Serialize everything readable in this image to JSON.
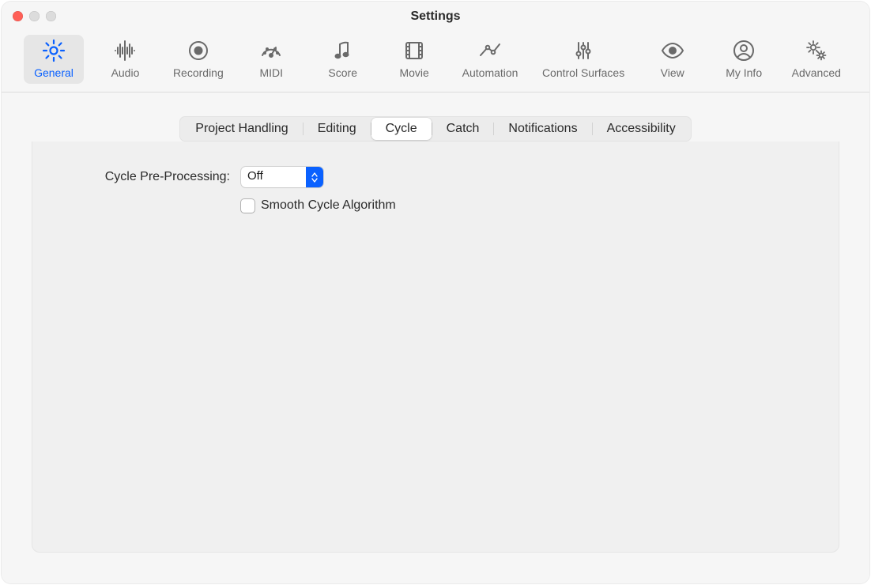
{
  "window": {
    "title": "Settings"
  },
  "toolbar": {
    "items": [
      {
        "id": "general",
        "label": "General"
      },
      {
        "id": "audio",
        "label": "Audio"
      },
      {
        "id": "recording",
        "label": "Recording"
      },
      {
        "id": "midi",
        "label": "MIDI"
      },
      {
        "id": "score",
        "label": "Score"
      },
      {
        "id": "movie",
        "label": "Movie"
      },
      {
        "id": "automation",
        "label": "Automation"
      },
      {
        "id": "control-surfaces",
        "label": "Control Surfaces"
      },
      {
        "id": "view",
        "label": "View"
      },
      {
        "id": "my-info",
        "label": "My Info"
      },
      {
        "id": "advanced",
        "label": "Advanced"
      }
    ],
    "active": "general"
  },
  "tabs": {
    "items": [
      {
        "id": "project-handling",
        "label": "Project Handling"
      },
      {
        "id": "editing",
        "label": "Editing"
      },
      {
        "id": "cycle",
        "label": "Cycle"
      },
      {
        "id": "catch",
        "label": "Catch"
      },
      {
        "id": "notifications",
        "label": "Notifications"
      },
      {
        "id": "accessibility",
        "label": "Accessibility"
      }
    ],
    "selected": "cycle"
  },
  "cycle": {
    "preprocessing_label": "Cycle Pre-Processing:",
    "preprocessing_value": "Off",
    "smooth_label": "Smooth Cycle Algorithm",
    "smooth_checked": false
  },
  "colors": {
    "accent": "#0a61ff"
  }
}
